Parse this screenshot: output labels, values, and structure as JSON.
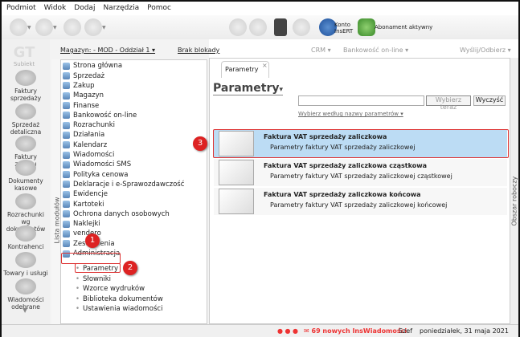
{
  "menu": [
    "Podmiot",
    "Widok",
    "Dodaj",
    "Narzędzia",
    "Pomoc"
  ],
  "toolbar": {
    "konto": "Konto",
    "insert": "InsERT",
    "abonament": "Abonament aktywny"
  },
  "header": {
    "magazyn": "Magazyn: - MOD - Oddział 1 ▾",
    "blokada": "Brak blokady",
    "crm": "CRM ▾",
    "bank": "Bankowość on-line ▾",
    "wyslij": "Wyślij/Odbierz ▾"
  },
  "logo": "Subiekt",
  "left_nav": [
    "Faktury sprzedaży",
    "Sprzedaż detaliczna",
    "Faktury zakupu",
    "Dokumenty kasowe",
    "Rozrachunki wg dokumentów",
    "Kontrahenci",
    "Towary i usługi",
    "Wiadomości odebrane"
  ],
  "modules_label": "Lista modułów",
  "modules": [
    "Strona główna",
    "Sprzedaż",
    "Zakup",
    "Magazyn",
    "Finanse",
    "Bankowość on-line",
    "Rozrachunki",
    "Działania",
    "Kalendarz",
    "Wiadomości",
    "Wiadomości SMS",
    "Polityka cenowa",
    "Deklaracje i e-Sprawozdawczość",
    "Ewidencje",
    "Kartoteki",
    "Ochrona danych osobowych",
    "Naklejki",
    "vendero",
    "Zestawienia",
    "Administracja"
  ],
  "admin_sub": [
    "Parametry",
    "Słowniki",
    "Wzorce wydruków",
    "Biblioteka dokumentów",
    "Ustawienia wiadomości"
  ],
  "tab": {
    "label": "Parametry",
    "close": "×"
  },
  "main": {
    "title": "Parametry",
    "search_value": "",
    "select_btn": "Wybierz teraz",
    "clear_btn": "Wyczyść",
    "filter": "Wybierz według nazwy parametrów ▾"
  },
  "items": [
    {
      "title": "Faktura VAT sprzedaży zaliczkowa",
      "desc": "Parametry faktury VAT sprzedaży zaliczkowej",
      "selected": true
    },
    {
      "title": "Faktura VAT sprzedaży zaliczkowa cząstkowa",
      "desc": "Parametry faktury VAT sprzedaży zaliczkowej cząstkowej"
    },
    {
      "title": "Faktura VAT sprzedaży zaliczkowa końcowa",
      "desc": "Parametry faktury VAT sprzedaży zaliczkowej końcowej"
    }
  ],
  "workspace_label": "Obszar roboczy",
  "status": {
    "messages": "69 nowych InsWiadomości",
    "user": "Szef",
    "date": "poniedziałek, 31 maja 2021"
  },
  "markers": [
    "1",
    "2",
    "3"
  ],
  "colors": {
    "accent_red": "#d22222",
    "selected": "#bcdcf4"
  }
}
